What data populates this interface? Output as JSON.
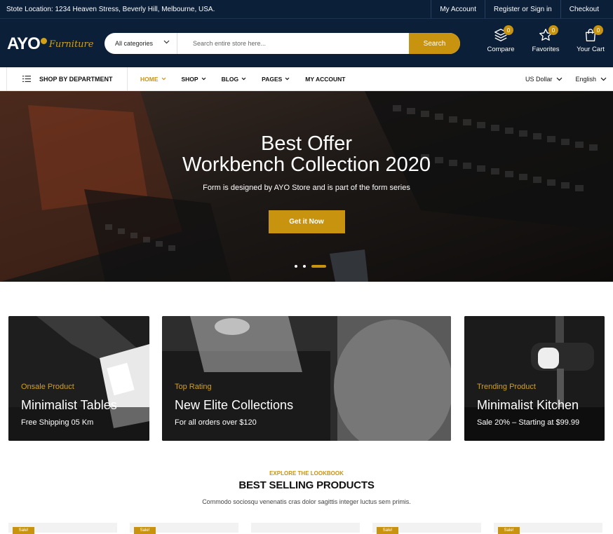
{
  "topbar": {
    "location": "Stote Location: 1234 Heaven Stress, Beverly Hill, Melbourne, USA.",
    "my_account": "My Account",
    "register": "Register",
    "or": "or",
    "sign_in": "Sign in",
    "checkout": "Checkout"
  },
  "header": {
    "logo_text": "AYO",
    "logo_sub": "Furniture",
    "search": {
      "category": "All categories",
      "placeholder": "Search entire store here...",
      "button": "Search"
    },
    "icons": [
      {
        "label": "Compare",
        "count": "0",
        "icon": "layers-icon"
      },
      {
        "label": "Favorites",
        "count": "0",
        "icon": "star-icon"
      },
      {
        "label": "Your Cart",
        "count": "0",
        "icon": "bag-icon"
      }
    ]
  },
  "nav": {
    "department": "SHOP BY DEPARTMENT",
    "items": [
      "HOME",
      "SHOP",
      "BLOG",
      "PAGES",
      "MY ACCOUNT"
    ],
    "currency": "US Dollar",
    "language": "English"
  },
  "hero": {
    "title1": "Best Offer",
    "title2": "Workbench Collection 2020",
    "desc": "Form is designed by AYO Store and is part of the form series",
    "cta": "Get it Now",
    "slides": 3,
    "active_slide": 3
  },
  "banners": [
    {
      "kicker": "Onsale Product",
      "title": "Minimalist Tables",
      "sub": "Free Shipping 05 Km"
    },
    {
      "kicker": "Top Rating",
      "title": "New Elite Collections",
      "sub": "For all orders over $120"
    },
    {
      "kicker": "Trending Product",
      "title": "Minimalist Kitchen",
      "sub": "Sale 20% – Starting at $99.99"
    }
  ],
  "section": {
    "eyebrow": "EXPLORE THE LOOKBOOK",
    "title": "BEST SELLING PRODUCTS",
    "lead": "Commodo sociosqu venenatis cras dolor sagittis integer luctus sem primis."
  },
  "products": [
    {
      "badge": "Sale!"
    },
    {
      "badge": "Sale!"
    },
    {
      "badge": ""
    },
    {
      "badge": "Sale!"
    },
    {
      "badge": "Sale!"
    }
  ],
  "colors": {
    "navy": "#0b1f38",
    "accent": "#c8930f"
  }
}
